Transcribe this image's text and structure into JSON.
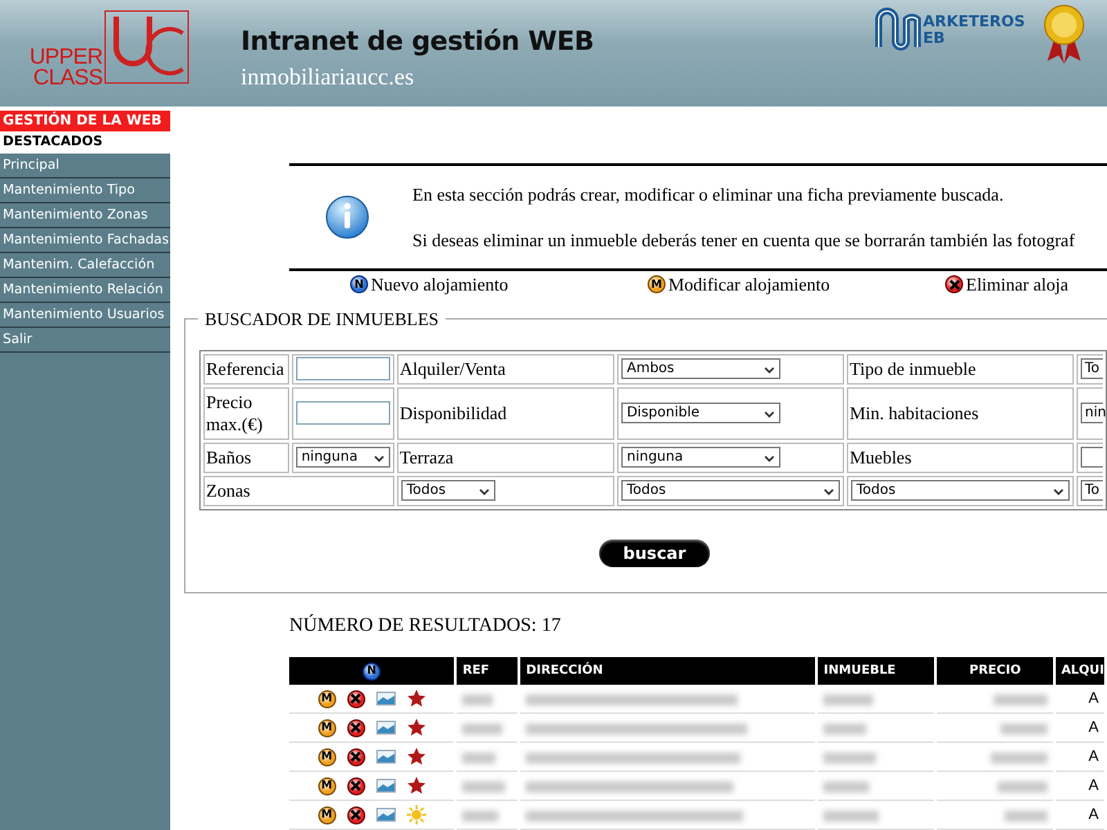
{
  "header": {
    "logo_text": [
      "UPPER",
      "CLASS"
    ],
    "title": "Intranet de gestión WEB",
    "subtitle": "inmobiliariaucc.es",
    "partner_logo_text": [
      "ARKETEROS",
      "EB"
    ]
  },
  "sidebar": {
    "section_title": "GESTIÓN DE LA WEB",
    "items": [
      {
        "label": "DESTACADOS",
        "selected": true
      },
      {
        "label": "Principal",
        "selected": false
      },
      {
        "label": "Mantenimiento Tipo",
        "selected": false
      },
      {
        "label": "Mantenimiento Zonas",
        "selected": false
      },
      {
        "label": "Mantenimiento Fachadas",
        "selected": false
      },
      {
        "label": "Mantenim. Calefacción",
        "selected": false
      },
      {
        "label": "Mantenimiento Relación",
        "selected": false
      },
      {
        "label": "Mantenimiento Usuarios",
        "selected": false
      },
      {
        "label": "Salir",
        "selected": false
      }
    ]
  },
  "info": {
    "paragraphs": [
      "En esta sección podrás crear, modificar o eliminar una ficha previamente buscada.",
      "Si deseas eliminar un inmueble deberás tener en cuenta que se borrarán también las fotograf"
    ]
  },
  "legend": [
    {
      "kind": "new",
      "glyph": "N",
      "label": "Nuevo alojamiento"
    },
    {
      "kind": "modify",
      "glyph": "M",
      "label": "Modificar alojamiento"
    },
    {
      "kind": "delete",
      "label": "Eliminar aloja"
    }
  ],
  "search": {
    "title": "BUSCADOR DE INMUEBLES",
    "rows": [
      [
        {
          "kind": "label",
          "text": "Referencia"
        },
        {
          "kind": "input"
        },
        {
          "kind": "label",
          "text": "Alquiler/Venta"
        },
        {
          "kind": "select",
          "value": "Ambos"
        },
        {
          "kind": "label",
          "text": "Tipo de inmueble"
        },
        {
          "kind": "cut",
          "value": "To"
        }
      ],
      [
        {
          "kind": "label",
          "text": "Precio max.(€)"
        },
        {
          "kind": "input"
        },
        {
          "kind": "label",
          "text": "Disponibilidad"
        },
        {
          "kind": "select",
          "value": "Disponible"
        },
        {
          "kind": "label",
          "text": "Min. habitaciones"
        },
        {
          "kind": "cut",
          "value": "nin"
        }
      ],
      [
        {
          "kind": "label",
          "text": "Baños"
        },
        {
          "kind": "select",
          "value": "ninguna"
        },
        {
          "kind": "label",
          "text": "Terraza"
        },
        {
          "kind": "select",
          "value": "ninguna"
        },
        {
          "kind": "label",
          "text": "Muebles"
        },
        {
          "kind": "cut"
        }
      ],
      [
        {
          "kind": "label",
          "text": "Zonas",
          "colspan": 2
        },
        {
          "kind": "wide",
          "value": "Todos"
        },
        {
          "kind": "wide",
          "value": "Todos"
        },
        {
          "kind": "wide",
          "value": "Todos"
        },
        {
          "kind": "cut",
          "value": "To"
        }
      ]
    ],
    "button": "buscar"
  },
  "results": {
    "count_text": "NÚMERO DE RESULTADOS: 17",
    "columns": [
      "REF",
      "DIRECCIÓN",
      "INMUEBLE",
      "PRECIO",
      "ALQUI"
    ],
    "new_glyph": "N",
    "rows": [
      {
        "modify_glyph": "M",
        "featured": true,
        "alquiler": "A"
      },
      {
        "modify_glyph": "M",
        "featured": true,
        "alquiler": "A"
      },
      {
        "modify_glyph": "M",
        "featured": true,
        "alquiler": "A"
      },
      {
        "modify_glyph": "M",
        "featured": true,
        "alquiler": "A"
      },
      {
        "modify_glyph": "M",
        "featured": false,
        "alquiler": "A"
      }
    ]
  }
}
